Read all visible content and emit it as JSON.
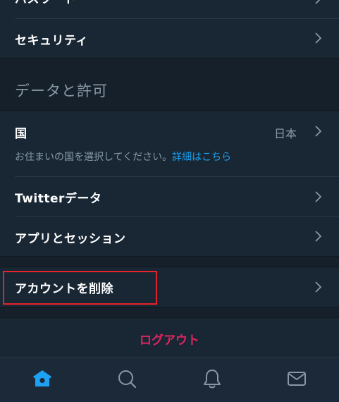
{
  "rows": {
    "password_label": "パスワード",
    "security_label": "セキュリティ",
    "country_label": "国",
    "country_value": "日本",
    "country_desc": "お住まいの国を選択してください。",
    "country_link": "詳細はこちら",
    "twitter_data_label": "Twitterデータ",
    "apps_sessions_label": "アプリとセッション",
    "delete_account_label": "アカウントを削除"
  },
  "section": {
    "data_permissions_title": "データと許可"
  },
  "logout_label": "ログアウト",
  "tabbar": {
    "items": [
      "home-icon",
      "search-icon",
      "bell-icon",
      "mail-icon"
    ],
    "active": "home-icon"
  },
  "colors": {
    "background": "#15202b",
    "cell": "#192734",
    "accent": "#1da1f2",
    "danger": "#e0245e",
    "secondary_text": "#8899a6",
    "highlight_box": "#e8222c"
  }
}
